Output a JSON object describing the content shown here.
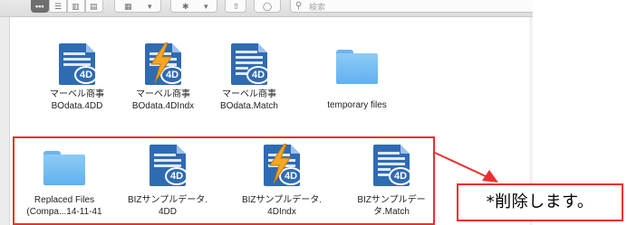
{
  "toolbar": {
    "view_buttons": [
      "icon-view",
      "list-view",
      "column-view",
      "gallery-view"
    ],
    "active_view": "icon-view",
    "group_menu": "group-menu",
    "action_menu": "action-gear",
    "share_button": "share",
    "tag_button": "tag",
    "search_placeholder": "検索"
  },
  "files_row1": [
    {
      "line1": "マーベル商事",
      "line2": "BOdata.4DD",
      "icon": "4d-document"
    },
    {
      "line1": "マーベル商事",
      "line2": "BOdata.4DIndx",
      "icon": "4d-index-document"
    },
    {
      "line1": "マーベル商事",
      "line2": "BOdata.Match",
      "icon": "4d-match-document"
    },
    {
      "line1": "",
      "line2": "temporary files",
      "icon": "folder"
    }
  ],
  "files_row2": [
    {
      "line1": "Replaced Files",
      "line2": "(Compa...14-11-41",
      "icon": "folder"
    },
    {
      "line1": "BIZサンプルデータ.",
      "line2": "4DD",
      "icon": "4d-document"
    },
    {
      "line1": "BIZサンプルデータ.",
      "line2": "4DIndx",
      "icon": "4d-index-document"
    },
    {
      "line1": "BIZサンプルデー",
      "line2": "タ.Match",
      "icon": "4d-match-document"
    }
  ],
  "annotation": {
    "text": "*削除します。",
    "color": "#e8312f"
  }
}
